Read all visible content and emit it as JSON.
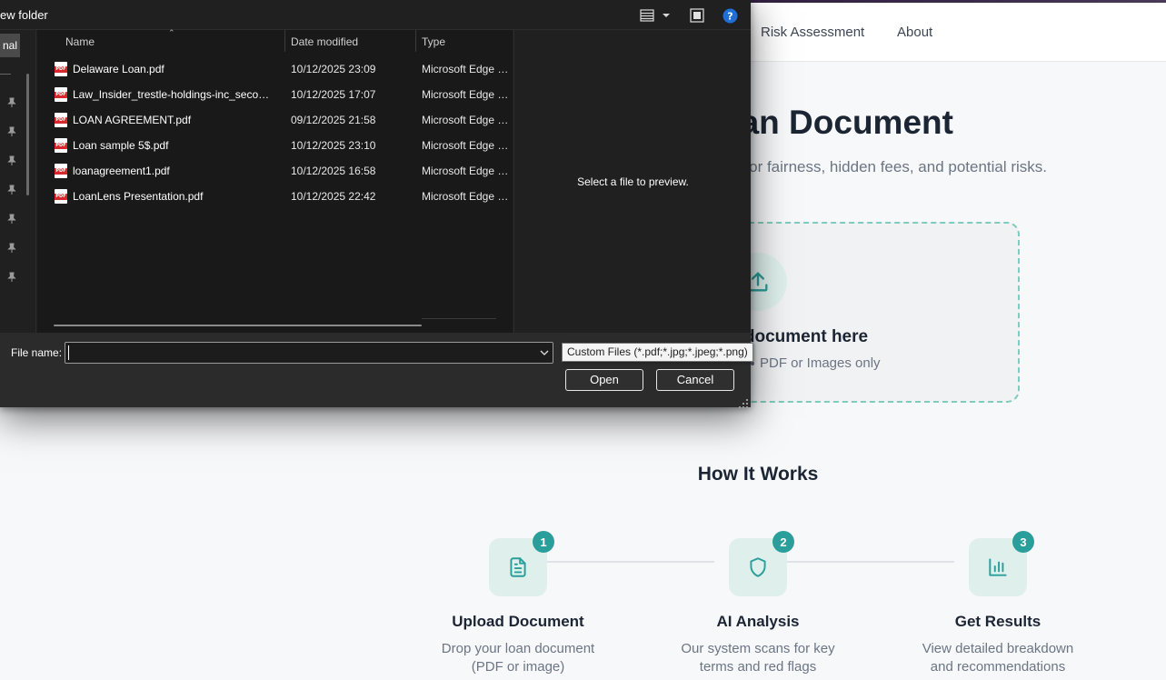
{
  "web": {
    "nav": {
      "risk_assessment": "Risk Assessment",
      "about": "About"
    },
    "hero": {
      "title_visible": "oan Document",
      "subtitle_visible": "e it for fairness, hidden fees, and potential risks."
    },
    "dropzone": {
      "title_visible": "n document here",
      "subtitle_visible": "PDF or Images only",
      "icon": "upload-icon"
    },
    "how_it_works": {
      "title": "How It Works",
      "steps": [
        {
          "number": "1",
          "title": "Upload Document",
          "desc_line1": "Drop your loan document",
          "desc_line2": "(PDF or image)",
          "icon": "document-icon"
        },
        {
          "number": "2",
          "title": "AI Analysis",
          "desc_line1": "Our system scans for key",
          "desc_line2": "terms and red flags",
          "icon": "shield-icon"
        },
        {
          "number": "3",
          "title": "Get Results",
          "desc_line1": "View detailed breakdown",
          "desc_line2": "and recommendations",
          "icon": "bar-chart-icon"
        }
      ]
    },
    "colors": {
      "accent": "#2a9e9a",
      "accent_light": "#dff0ec",
      "dashed_border": "#7fcbbd"
    }
  },
  "dialog": {
    "toolbar": {
      "new_folder_visible": "ew folder",
      "icons": [
        "view-options-icon",
        "chevron-down-icon",
        "preview-pane-icon",
        "help-icon"
      ]
    },
    "nav_pane": {
      "selected_visible": "nal"
    },
    "columns": {
      "name": "Name",
      "date_modified": "Date modified",
      "type": "Type"
    },
    "files": [
      {
        "name": "Delaware Loan.pdf",
        "date": "10/12/2025 23:09",
        "type": "Microsoft Edge PDF Document"
      },
      {
        "name": "Law_Insider_trestle-holdings-inc_second...",
        "date": "10/12/2025 17:07",
        "type": "Microsoft Edge PDF Document"
      },
      {
        "name": "LOAN AGREEMENT.pdf",
        "date": "09/12/2025 21:58",
        "type": "Microsoft Edge PDF Document"
      },
      {
        "name": "Loan sample 5$.pdf",
        "date": "10/12/2025 23:10",
        "type": "Microsoft Edge PDF Document"
      },
      {
        "name": "loanagreement1.pdf",
        "date": "10/12/2025 16:58",
        "type": "Microsoft Edge PDF Document"
      },
      {
        "name": "LoanLens Presentation.pdf",
        "date": "10/12/2025 22:42",
        "type": "Microsoft Edge PDF Document"
      }
    ],
    "preview_text": "Select a file to preview.",
    "file_name_label": "File name:",
    "file_name_value": "",
    "file_type_tooltip": "Custom Files (*.pdf;*.jpg;*.jpeg;*.png)",
    "open_label": "Open",
    "cancel_label": "Cancel"
  }
}
